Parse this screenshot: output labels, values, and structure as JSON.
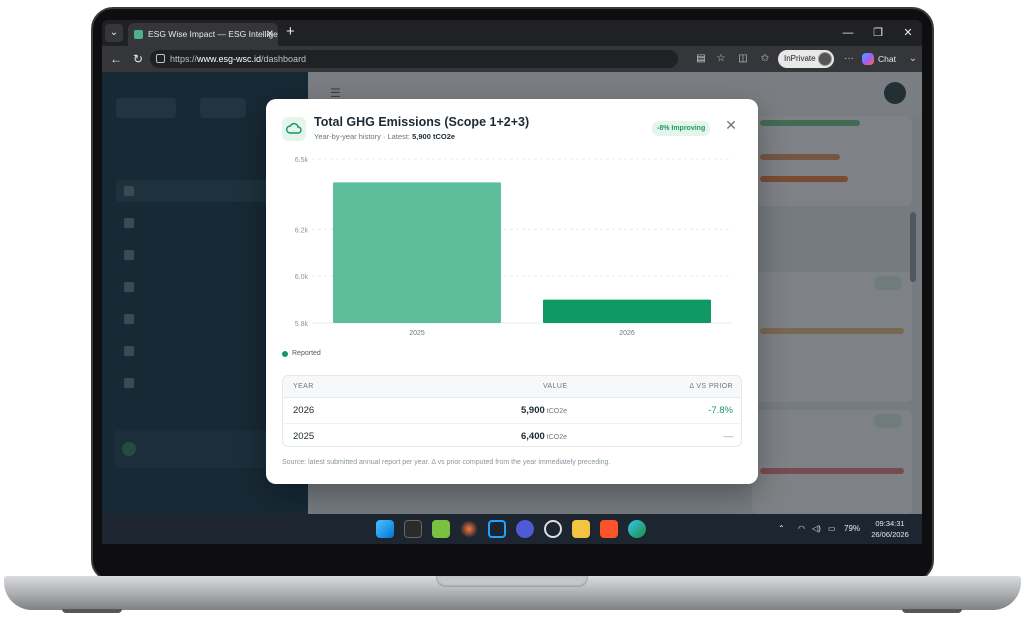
{
  "browser": {
    "tab_title": "ESG Wise Impact — ESG Intelligen",
    "url_scheme": "https://",
    "url_host": "www.esg-wsc.id",
    "url_path": "/dashboard",
    "inprivate_label": "InPrivate",
    "chat_label": "Chat"
  },
  "modal": {
    "title": "Total GHG Emissions (Scope 1+2+3)",
    "subtitle_prefix": "Year-by-year history · Latest:",
    "subtitle_latest": "5,900 tCO2e",
    "badge": "-8% Improving",
    "legend": "Reported",
    "table": {
      "headers": [
        "YEAR",
        "VALUE",
        "Δ VS PRIOR"
      ],
      "rows": [
        {
          "year": "2026",
          "value": "5,900",
          "unit": "tCO2e",
          "delta": "-7.8%"
        },
        {
          "year": "2025",
          "value": "6,400",
          "unit": "tCO2e",
          "delta": "—"
        }
      ]
    },
    "footnote": "Source: latest submitted annual report per year. Δ vs prior computed from the year immediately preceding."
  },
  "chart_data": {
    "type": "bar",
    "categories": [
      "2025",
      "2026"
    ],
    "values": [
      6400,
      5900
    ],
    "colors": [
      "#5cbe9b",
      "#0f9a64"
    ],
    "ylim": [
      5800,
      6500
    ],
    "yticks": [
      5800,
      6000,
      6200,
      6500
    ],
    "ytick_labels": [
      "5.8k",
      "6.0k",
      "6.2k",
      "6.5k"
    ],
    "grid": true,
    "legend_position": "bottom-left"
  },
  "taskbar": {
    "battery": "79%",
    "time": "09:34:31",
    "date": "26/06/2026"
  },
  "colors": {
    "accent": "#0f9a64",
    "sidebar": "#1b3d4f"
  }
}
